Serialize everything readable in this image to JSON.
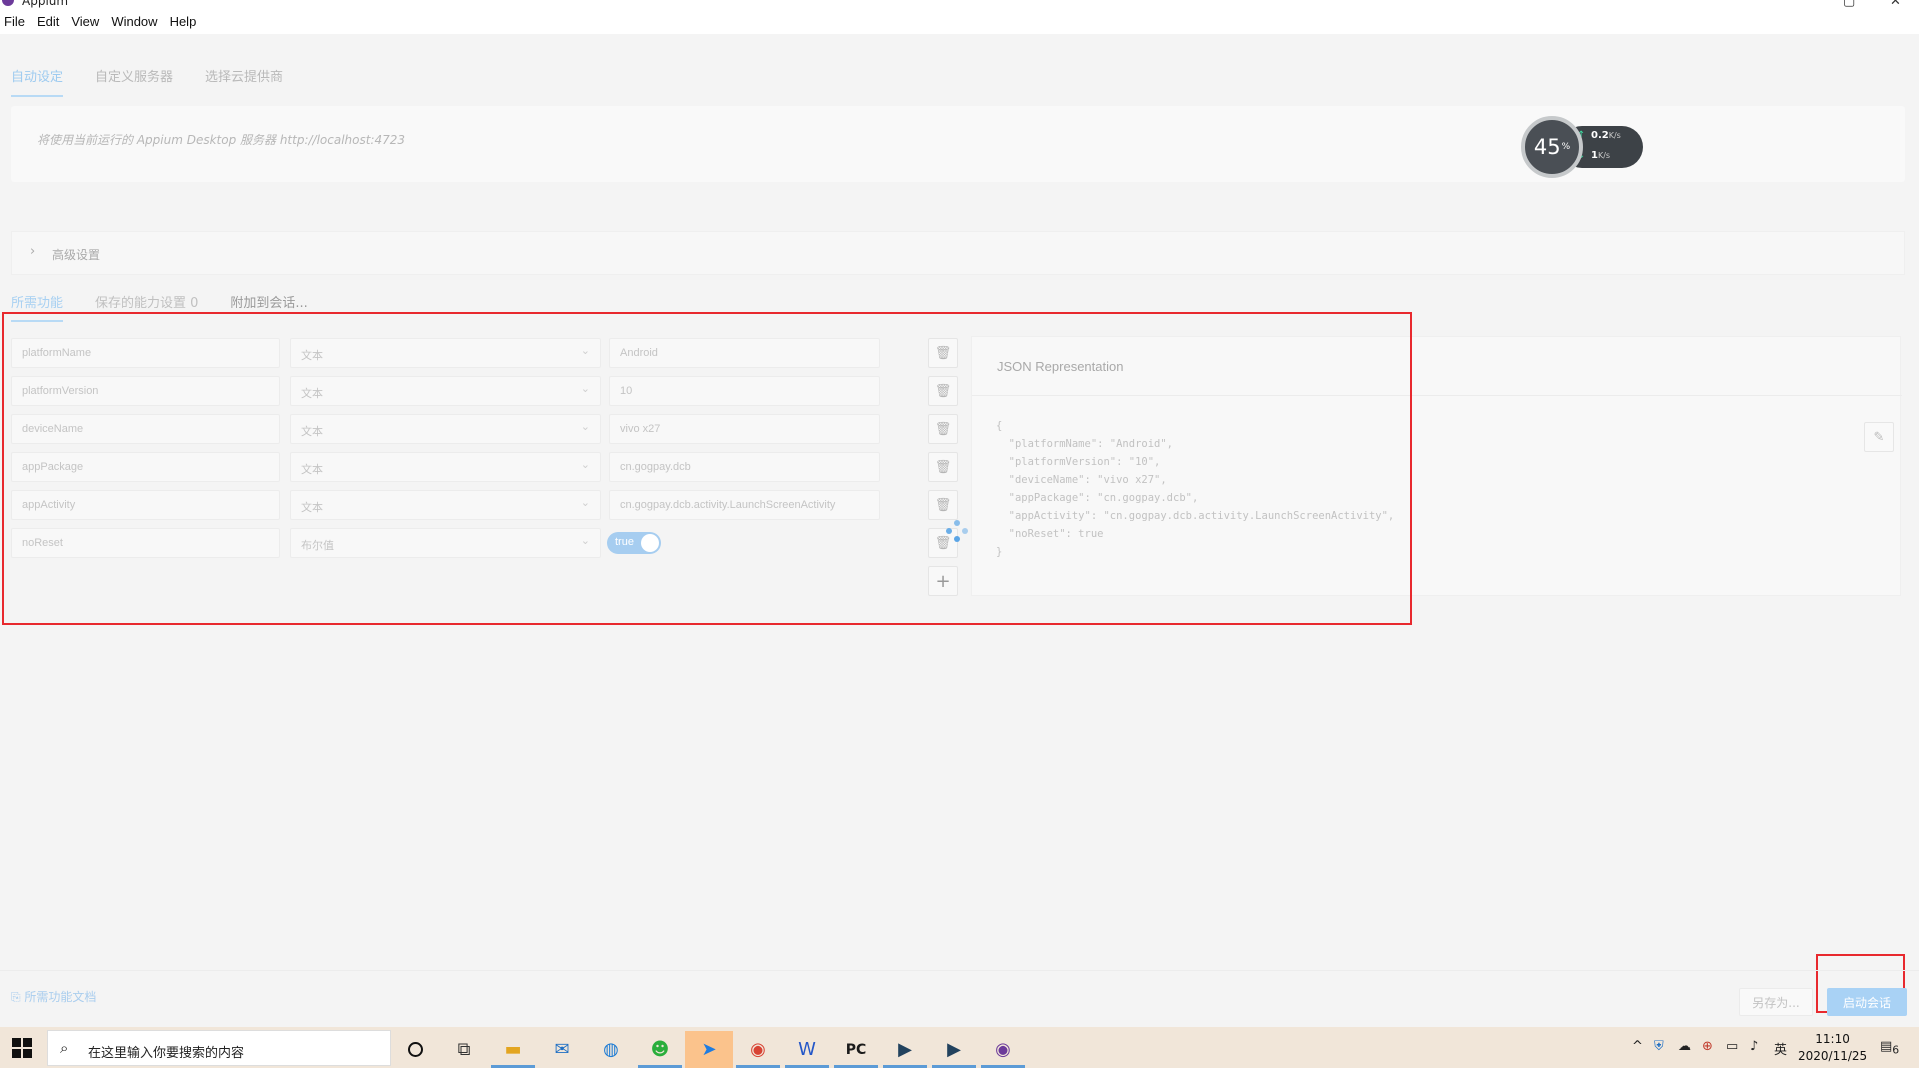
{
  "window": {
    "title": "Appium",
    "controls": [
      "▢",
      "✕"
    ]
  },
  "menu": [
    "File",
    "Edit",
    "View",
    "Window",
    "Help"
  ],
  "top_tabs": [
    "自动设定",
    "自定义服务器",
    "选择云提供商"
  ],
  "server_text": "将使用当前运行的 Appium Desktop 服务器 http://localhost:4723",
  "netmeter": {
    "percent": "45",
    "unit": "%",
    "up": "0.2",
    "up_unit": "K/s",
    "down": "1",
    "down_unit": "K/s"
  },
  "advanced_label": "高级设置",
  "cap_tabs": [
    "所需功能",
    "保存的能力设置 0",
    "附加到会话..."
  ],
  "capabilities": [
    {
      "name": "platformName",
      "type": "文本",
      "value": "Android"
    },
    {
      "name": "platformVersion",
      "type": "文本",
      "value": "10"
    },
    {
      "name": "deviceName",
      "type": "文本",
      "value": "vivo x27"
    },
    {
      "name": "appPackage",
      "type": "文本",
      "value": "cn.gogpay.dcb"
    },
    {
      "name": "appActivity",
      "type": "文本",
      "value": "cn.gogpay.dcb.activity.LaunchScreenActivity"
    },
    {
      "name": "noReset",
      "type": "布尔值",
      "value": "true"
    }
  ],
  "json_panel": {
    "title": "JSON Representation",
    "body": "{\n  \"platformName\": \"Android\",\n  \"platformVersion\": \"10\",\n  \"deviceName\": \"vivo x27\",\n  \"appPackage\": \"cn.gogpay.dcb\",\n  \"appActivity\": \"cn.gogpay.dcb.activity.LaunchScreenActivity\",\n  \"noReset\": true\n}"
  },
  "footer": {
    "docs_link": "所需功能文档",
    "save_as": "另存为...",
    "start_session": "启动会话"
  },
  "taskbar": {
    "search_placeholder": "在这里输入你要搜索的内容",
    "clock_time": "11:10",
    "clock_date": "2020/11/25",
    "ime": "英",
    "notification_count": "6"
  },
  "colors": {
    "highlight": "#e8292e",
    "accent": "#a9d2f5",
    "taskbar": "#f1e6d9"
  }
}
